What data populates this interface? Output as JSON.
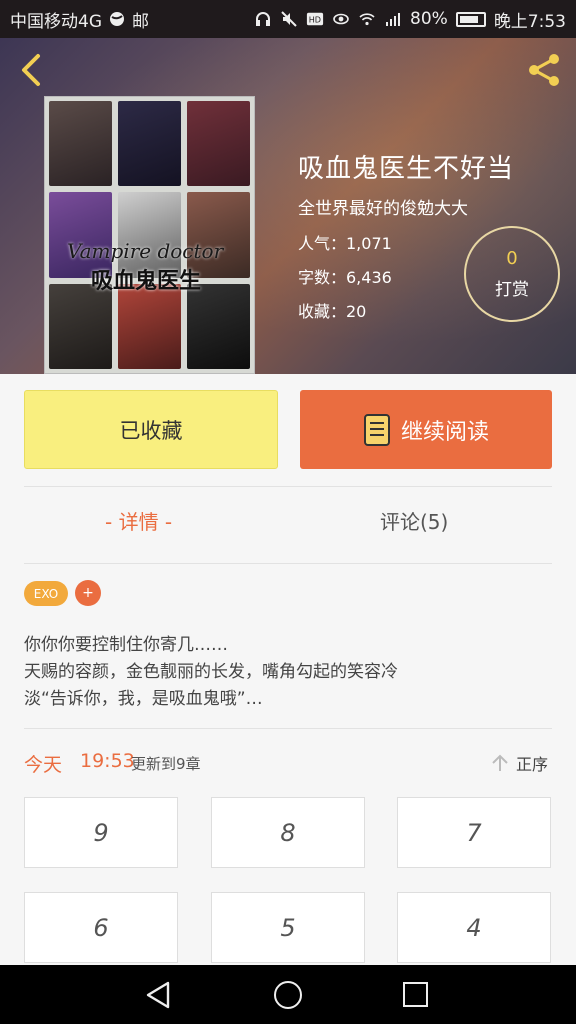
{
  "status_bar": {
    "carrier": "中国移动4G",
    "mail": "邮",
    "battery": "80%",
    "time": "晚上7:53"
  },
  "book": {
    "title": "吸血鬼医生不好当",
    "author": "全世界最好的俊勉大大",
    "popularity": "人气：1,071",
    "words": "字数：6,436",
    "favorites": "收藏：20",
    "cover_title": "Vampire doctor",
    "cover_subtitle": "吸血鬼医生"
  },
  "reward": {
    "count": "0",
    "label": "打赏"
  },
  "actions": {
    "collected": "已收藏",
    "continue": "继续阅读"
  },
  "tabs": {
    "details": "- 详情 -",
    "comments": "评论(5)"
  },
  "tags": [
    "EXO",
    "+"
  ],
  "description": [
    "  你你你要控制住你寄几……",
    "  天赐的容颜，金色靓丽的长发，嘴角勾起的笑容冷",
    "淡“告诉你，我，是吸血鬼哦”…"
  ],
  "update": {
    "today": "今天",
    "time": "19:53",
    "text": "更新到9章",
    "order": "正序"
  },
  "chapters": [
    "9",
    "8",
    "7",
    "6",
    "5",
    "4"
  ],
  "colors": {
    "accent": "#ea6d40",
    "collected_bg": "#f9ef7f",
    "tag": "#f2a93c"
  },
  "icons": [
    "back-arrow-icon",
    "share-icon",
    "book-icon",
    "arrow-up-icon"
  ]
}
